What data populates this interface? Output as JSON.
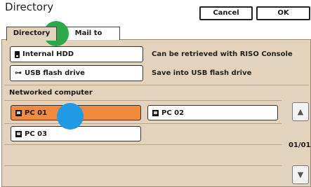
{
  "header": {
    "title": "Directory",
    "cancel_label": "Cancel",
    "ok_label": "OK"
  },
  "tabs": [
    {
      "label": "Directory",
      "active": true
    },
    {
      "label": "Mail to",
      "active": false
    }
  ],
  "options": [
    {
      "label": "Internal HDD",
      "icon": "hdd-icon",
      "description": "Can be retrieved with RISO Console"
    },
    {
      "label": "USB flash drive",
      "icon": "usb-icon",
      "description": "Save into USB flash drive"
    }
  ],
  "networked": {
    "section_label": "Networked computer",
    "computers": [
      {
        "label": "PC 01",
        "selected": true
      },
      {
        "label": "PC 02",
        "selected": false
      },
      {
        "label": "PC 03",
        "selected": false
      }
    ],
    "page_indicator": "01/01"
  },
  "colors": {
    "panel_bg": "#e3d3bc",
    "selected_bg": "#ef8a3e",
    "marker_green": "#2ea84a",
    "marker_blue": "#1f9be6"
  }
}
